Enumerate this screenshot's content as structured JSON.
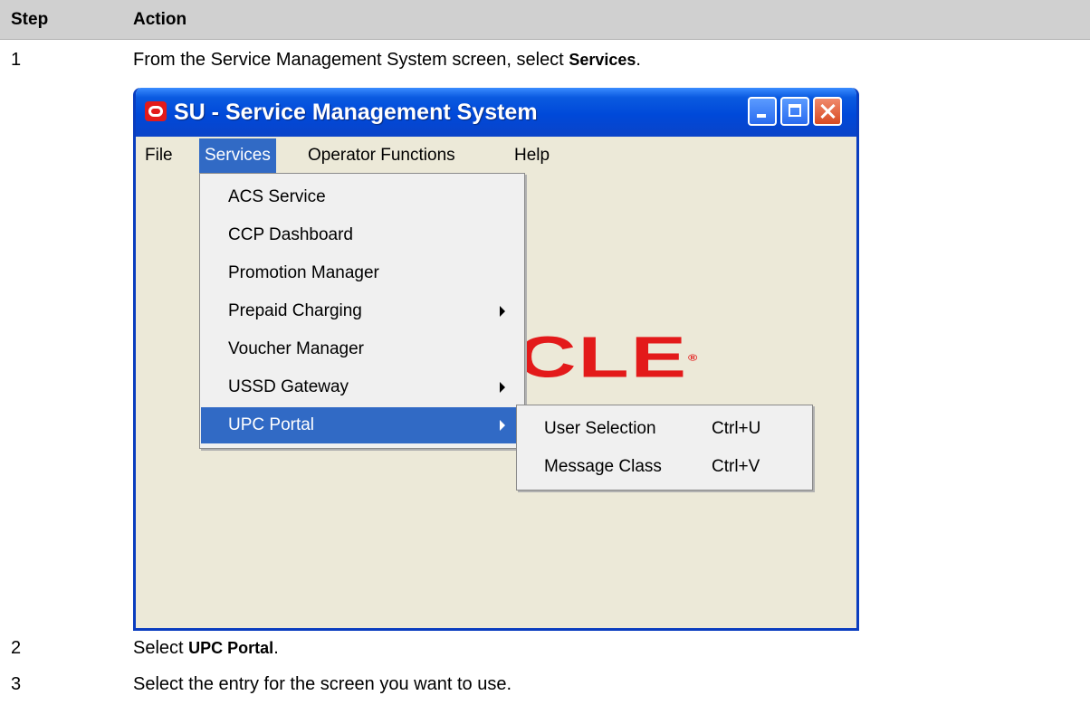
{
  "table": {
    "headers": [
      "Step",
      "Action"
    ],
    "steps": [
      {
        "number": "1",
        "text": "From the Service Management System screen, select ",
        "bold": "Services",
        "suffix": "."
      },
      {
        "number": "2",
        "text": "Select ",
        "bold": "UPC Portal",
        "suffix": "."
      },
      {
        "number": "3",
        "text": "Select the entry for the screen you want to use.",
        "bold": "",
        "suffix": ""
      }
    ]
  },
  "window": {
    "title": "SU - Service Management System",
    "menubar": [
      "File",
      "Services",
      "Operator Functions",
      "Help"
    ],
    "logo_text": "CLE",
    "logo_mark": "®",
    "services_menu": [
      {
        "label": "ACS Service",
        "submenu": false
      },
      {
        "label": "CCP Dashboard",
        "submenu": false
      },
      {
        "label": "Promotion Manager",
        "submenu": false
      },
      {
        "label": "Prepaid Charging",
        "submenu": true
      },
      {
        "label": "Voucher Manager",
        "submenu": false
      },
      {
        "label": "USSD Gateway",
        "submenu": true
      },
      {
        "label": "UPC Portal",
        "submenu": true,
        "highlighted": true
      }
    ],
    "upc_submenu": [
      {
        "label": "User Selection",
        "shortcut": "Ctrl+U"
      },
      {
        "label": "Message Class",
        "shortcut": "Ctrl+V"
      }
    ],
    "colors": {
      "titlebar": "#0a5ae0",
      "highlight": "#316ac5",
      "logo": "#e31a1a",
      "client": "#ece9d8"
    }
  }
}
